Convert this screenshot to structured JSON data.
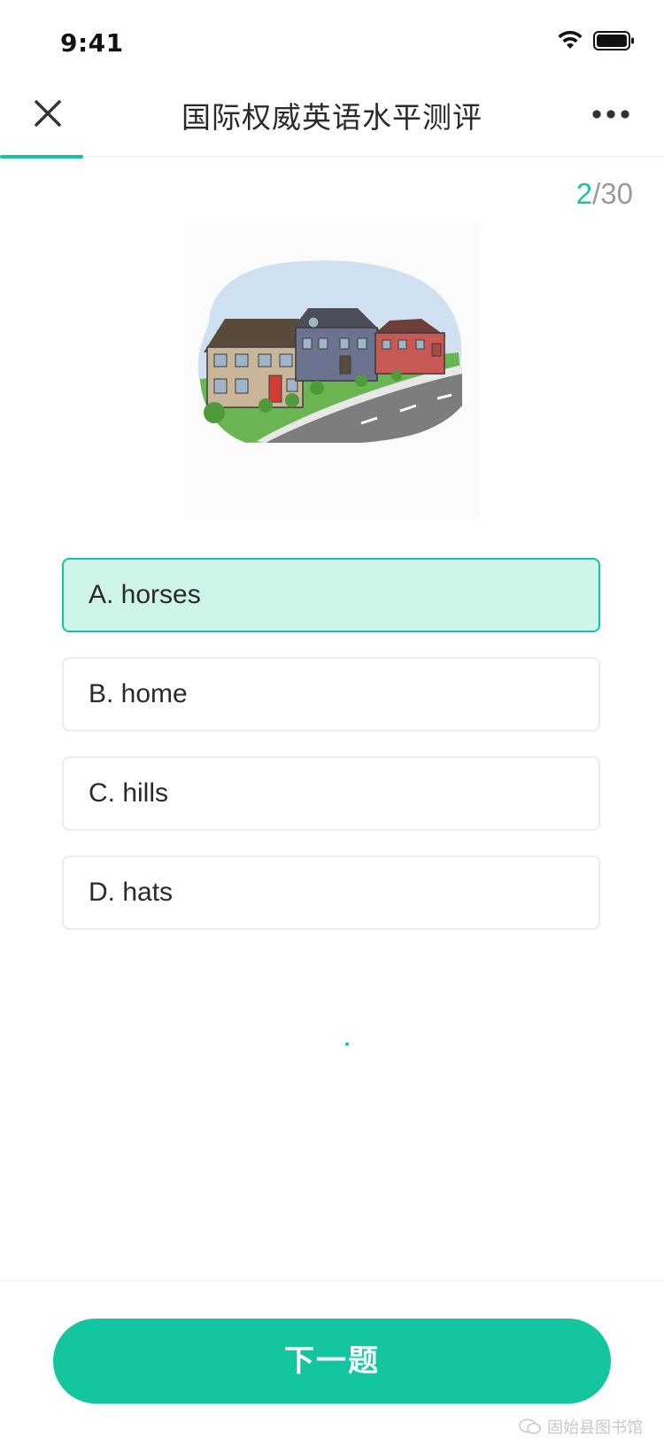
{
  "status_bar": {
    "time": "9:41",
    "icons": [
      "wifi-icon",
      "battery-icon"
    ]
  },
  "header": {
    "title": "国际权威英语水平测评",
    "left_icon": "close-icon",
    "right_icon": "more-icon"
  },
  "progress": {
    "fraction": 0.125
  },
  "counter": {
    "current": "2",
    "separator": "/",
    "total": "30"
  },
  "question": {
    "image": "houses-street-illustration",
    "options": [
      {
        "letter": "A.",
        "text": "horses",
        "label": "A. horses",
        "selected": true
      },
      {
        "letter": "B.",
        "text": "home",
        "label": "B. home",
        "selected": false
      },
      {
        "letter": "C.",
        "text": "hills",
        "label": "C. hills",
        "selected": false
      },
      {
        "letter": "D.",
        "text": "hats",
        "label": "D. hats",
        "selected": false
      }
    ]
  },
  "footer": {
    "next_button_label": "下一题",
    "watermark": "固始县图书馆"
  },
  "colors": {
    "accent": "#14c6a0",
    "selected_bg": "#cdf5ea",
    "option_border": "#ececec",
    "muted_text": "#9a9a9a"
  }
}
